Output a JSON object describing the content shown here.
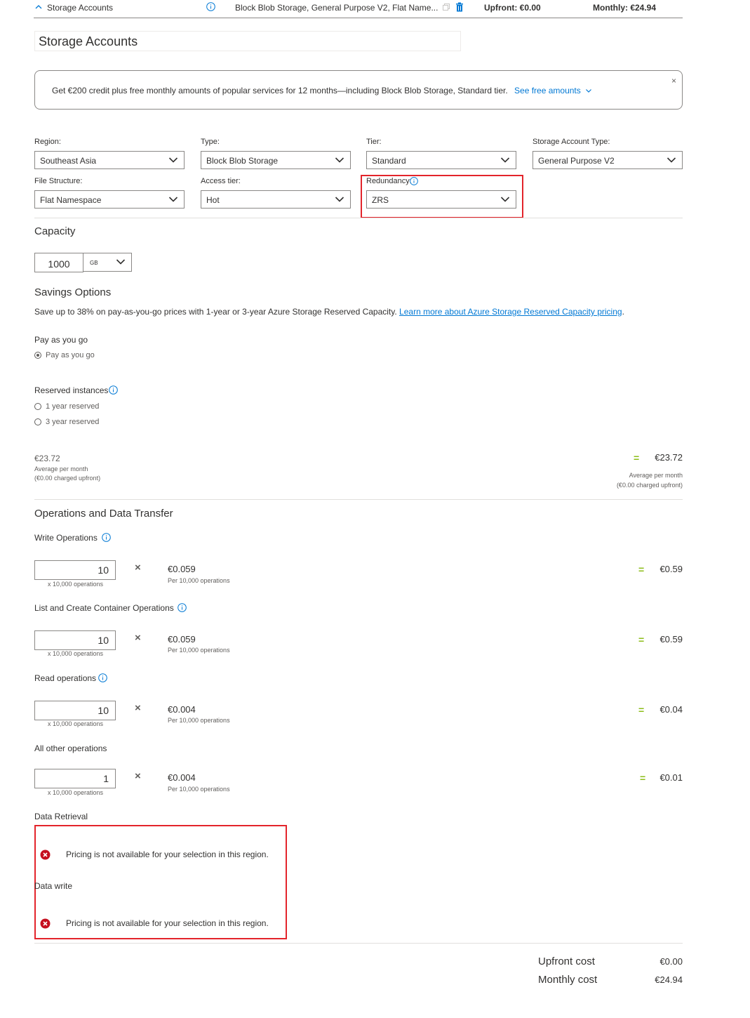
{
  "topbar": {
    "title": "Storage Accounts",
    "description": "Block Blob Storage, General Purpose V2, Flat Name...",
    "upfront": "Upfront: €0.00",
    "monthly": "Monthly: €24.94"
  },
  "estimate_name": "Storage Accounts",
  "banner": {
    "message": "Get €200 credit plus free monthly amounts of popular services for 12 months—including Block Blob Storage, Standard tier.",
    "link": "See free amounts",
    "close": "×"
  },
  "config": {
    "region": {
      "label": "Region:",
      "value": "Southeast Asia"
    },
    "type": {
      "label": "Type:",
      "value": "Block Blob Storage"
    },
    "tier": {
      "label": "Tier:",
      "value": "Standard"
    },
    "account_type": {
      "label": "Storage Account Type:",
      "value": "General Purpose V2"
    },
    "file_structure": {
      "label": "File Structure:",
      "value": "Flat Namespace"
    },
    "access_tier": {
      "label": "Access tier:",
      "value": "Hot"
    },
    "redundancy": {
      "label": "Redundancy:",
      "value": "ZRS"
    }
  },
  "capacity": {
    "heading": "Capacity",
    "value": "1000",
    "unit": "GB"
  },
  "savings": {
    "heading": "Savings Options",
    "text": "Save up to 38% on pay-as-you-go prices with 1-year or 3-year Azure Storage Reserved Capacity.",
    "link": "Learn more about Azure Storage Reserved Capacity pricing",
    "period": ".",
    "payg_heading": "Pay as you go",
    "payg_option": "Pay as you go",
    "reserved_heading": "Reserved instances",
    "reserved_1": "1 year reserved",
    "reserved_3": "3 year reserved",
    "left_price": "€23.72",
    "left_avg": "Average per month",
    "left_upfront": "(€0.00 charged upfront)",
    "eq": "=",
    "right_price": "€23.72",
    "right_avg": "Average per month",
    "right_upfront": "(€0.00 charged upfront)"
  },
  "ops": {
    "heading": "Operations and Data Transfer",
    "times": "×",
    "eq": "=",
    "items": [
      {
        "label": "Write Operations",
        "qty": "10",
        "unit": "x 10,000 operations",
        "price": "€0.059",
        "per": "Per 10,000 operations",
        "total": "€0.59"
      },
      {
        "label": "List and Create Container Operations",
        "qty": "10",
        "unit": "x 10,000 operations",
        "price": "€0.059",
        "per": "Per 10,000 operations",
        "total": "€0.59"
      },
      {
        "label": "Read operations",
        "qty": "10",
        "unit": "x 10,000 operations",
        "price": "€0.004",
        "per": "Per 10,000 operations",
        "total": "€0.04"
      },
      {
        "label": "All other operations",
        "qty": "1",
        "unit": "x 10,000 operations",
        "price": "€0.004",
        "per": "Per 10,000 operations",
        "total": "€0.01"
      }
    ]
  },
  "retrieval": {
    "heading": "Data Retrieval",
    "error": "Pricing is not available for your selection in this region."
  },
  "data_write": {
    "heading": "Data write",
    "error": "Pricing is not available for your selection in this region."
  },
  "totals": {
    "upfront_label": "Upfront cost",
    "upfront_value": "€0.00",
    "monthly_label": "Monthly cost",
    "monthly_value": "€24.94"
  },
  "colors": {
    "accent": "#0078d4",
    "equals": "#8cbd18",
    "highlight": "#e3242b",
    "error": "#c50f1f"
  }
}
